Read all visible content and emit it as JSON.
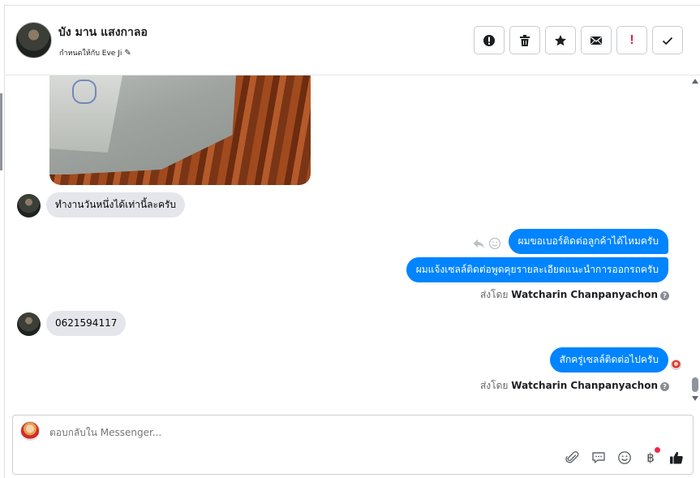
{
  "header": {
    "contact_name": "บัง มาน แสงกาลอ",
    "assigned_to": "กำหนดให้กับ Eve Ji",
    "toolbar": [
      {
        "name": "spam-button",
        "icon": "alert-circle-icon"
      },
      {
        "name": "delete-button",
        "icon": "trash-icon"
      },
      {
        "name": "star-button",
        "icon": "star-icon"
      },
      {
        "name": "mark-unread-button",
        "icon": "envelope-icon"
      },
      {
        "name": "follow-up-button",
        "icon": "exclamation-icon",
        "label": "!"
      },
      {
        "name": "done-button",
        "icon": "check-icon"
      }
    ]
  },
  "messages": {
    "in_1": "ทำงานวันหนึ่งได้เท่านี้ละครับ",
    "out_1": "ผมขอเบอร์ติดต่อลูกค้าได้ไหมครับ",
    "out_2": "ผมแจ้งเซลล์ติดต่อพูดคุยรายละเอียดแนะนำการออกรถครับ",
    "sent_by_prefix": "ส่งโดย",
    "sent_by_name": "Watcharin Chanpanyachon",
    "in_2": "0621594117",
    "out_3": "สักครู่เซลล์ติดต่อไปครับ",
    "sent_by_prefix_2": "ส่งโดย",
    "sent_by_name_2": "Watcharin Chanpanyachon"
  },
  "composer": {
    "placeholder": "ตอบกลับใน Messenger...",
    "icons": [
      "paperclip-icon",
      "saved-reply-icon",
      "emoji-icon",
      "baht-icon",
      "thumbs-up-icon"
    ],
    "baht_symbol": "฿"
  },
  "colors": {
    "outgoing_bubble": "#0084ff",
    "incoming_bubble": "#e4e6eb",
    "alert_red": "#e41e3f"
  }
}
